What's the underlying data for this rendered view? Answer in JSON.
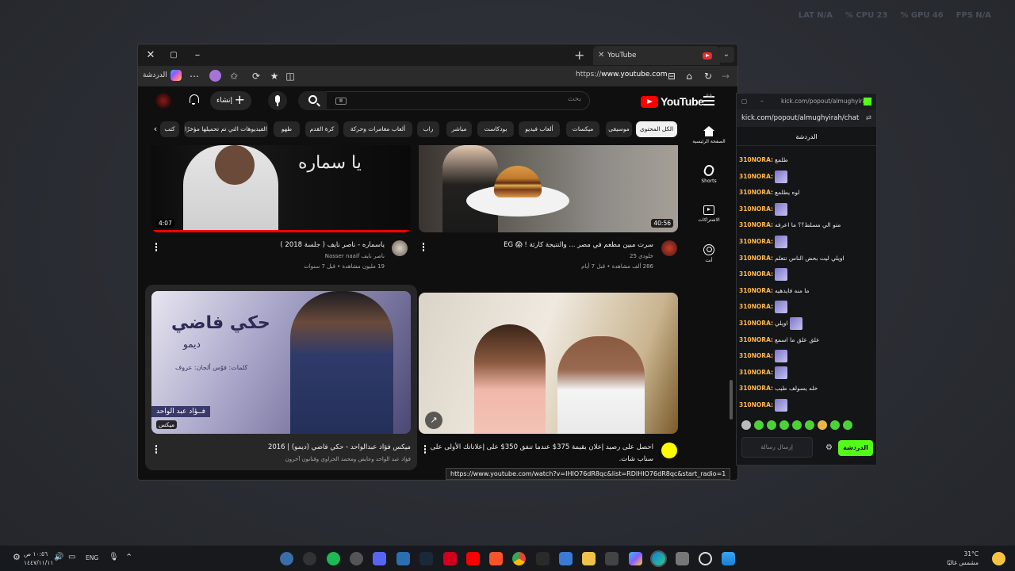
{
  "perf": {
    "fps": "FPS",
    "fps_val": "N/A",
    "gpu": "GPU",
    "gpu_val": "46 %",
    "cpu": "CPU",
    "cpu_val": "23 %",
    "lat": "LAT",
    "lat_val": "N/A"
  },
  "browser": {
    "tab_title": "YouTube",
    "url_prefix": "https://",
    "url_domain": "www.youtube.com",
    "chat_label": "الدردشة",
    "status_url": "https://www.youtube.com/watch?v=IHIO76dR8qc&list=RDIHIO76dR8qc&start_radio=1"
  },
  "youtube": {
    "logo_text": "YouTube",
    "country": "SA",
    "search_placeholder": "بحث",
    "create_label": "إنشاء",
    "chips": [
      "الكل",
      "المحتوى",
      "موسيقى",
      "ميكسات",
      "ألعاب فيديو",
      "بودكاست",
      "مباشر",
      "راب",
      "ألعاب مغامرات وحركة",
      "كرة القدم",
      "طهو",
      "الفيديوهات التي تم تحميلها مؤخرًا",
      "كتب"
    ],
    "rail": {
      "home": "الصفحة الرئيسية",
      "shorts": "Shorts",
      "subs": "الاشتراكات",
      "you": "أنت"
    },
    "videos": [
      {
        "title": "سرت مبين مطعم في مصر ... والنتيجة كارثة ! 😱 EG",
        "channel": "خلودي 25",
        "meta": "286 ألف مشاهدة • قبل 7 أيام",
        "duration": "40:56",
        "thumb_text": ""
      },
      {
        "title": "ياسماره - ناصر نايف ( جلسة 2018 )",
        "channel": "ناصر نايف Nasser naaif",
        "meta": "19 مليون مشاهدة • قبل 7 سنوات",
        "duration": "4:07",
        "thumb_text": "يا سماره"
      },
      {
        "title": "احصل على رصيد إعلان بقيمة 375$ عندما تنفق 350$ على إعلاناتك الأولى على",
        "title2": "سناب شات.",
        "channel": "",
        "meta": "",
        "duration": "",
        "thumb_text": ""
      },
      {
        "title": "ميكس فؤاد عبدالواحد - حكي فاضي (ديمو) | 2016",
        "channel": "فؤاد عبد الواحد وعايض ومحمد الحزاوي وفنانون آخرون",
        "meta": "",
        "duration": "",
        "badge": "ميكس",
        "thumb_title": "حكي فاضي",
        "thumb_sub": "ديمو",
        "thumb_credits": "كلمات: فوّس   ألحان: عروف",
        "thumb_artist": "فــؤاد عبد الواحد"
      }
    ]
  },
  "kick": {
    "window_url": "kick.com/popout/almughyirah/",
    "address": "kick.com/popout/almughyirah/chat",
    "header": "الدردشة",
    "messages": [
      {
        "user": "310NORA:",
        "msg": "طلمع",
        "emote": false
      },
      {
        "user": "310NORA:",
        "msg": "",
        "emote": true
      },
      {
        "user": "310NORA:",
        "msg": "لوه يطلمع",
        "emote": false
      },
      {
        "user": "310NORA:",
        "msg": "",
        "emote": true
      },
      {
        "user": "310NORA:",
        "msg": "متو الي مسلط؟؟ ما اعرفه",
        "emote": false
      },
      {
        "user": "310NORA:",
        "msg": "",
        "emote": true
      },
      {
        "user": "310NORA:",
        "msg": "اويلي ليت بحض الناس تتعلم",
        "emote": false
      },
      {
        "user": "310NORA:",
        "msg": "",
        "emote": true
      },
      {
        "user": "310NORA:",
        "msg": "ما منه فايدهيه",
        "emote": false
      },
      {
        "user": "310NORA:",
        "msg": "",
        "emote": true
      },
      {
        "user": "310NORA:",
        "msg": "اويلي",
        "emote": true
      },
      {
        "user": "310NORA:",
        "msg": "علق علق ما اسمع",
        "emote": false
      },
      {
        "user": "310NORA:",
        "msg": "",
        "emote": true
      },
      {
        "user": "310NORA:",
        "msg": "",
        "emote": true
      },
      {
        "user": "310NORA:",
        "msg": "خله يسولف طيب",
        "emote": false
      },
      {
        "user": "310NORA:",
        "msg": "",
        "emote": true
      }
    ],
    "input_placeholder": "إرسال رسالة",
    "send_label": "الدردشة"
  },
  "taskbar": {
    "time": "١٠:٥٦ ص",
    "date": "١٤٤٧/١١/١١",
    "lang": "ENG",
    "weather_temp": "31°C",
    "weather_desc": "مشمس غالبًا"
  },
  "colors": {
    "yt_red": "#ff0000",
    "kick_green": "#53fc18",
    "chat_user": "#ffb74d"
  }
}
